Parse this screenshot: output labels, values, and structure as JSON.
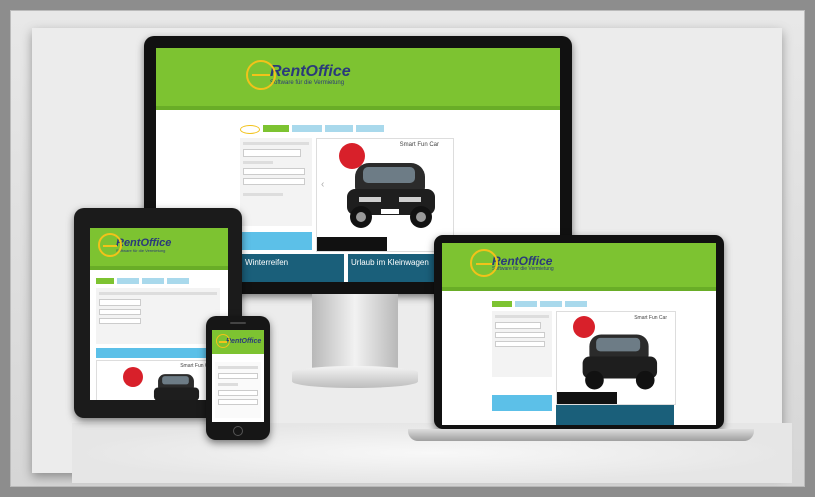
{
  "brand": {
    "name": "RentOffice",
    "tagline": "Software für die Vermietung",
    "colors": {
      "green": "#7dc331",
      "blue": "#2a3a7a",
      "yellow": "#f2c21a",
      "teal": "#1a5f7a",
      "red": "#d8202a",
      "cyan": "#5cc0e8"
    }
  },
  "desktop": {
    "promo_title": "Smart Fun Car",
    "tile1_title": "Winterreifen",
    "tile2_title": "Urlaub im Kleinwagen"
  },
  "laptop": {
    "promo_title": "Smart Fun Car"
  },
  "tablet": {
    "promo_title": "Smart Fun Car"
  },
  "icons": [
    "logo-ring-icon",
    "chevron-left-icon",
    "car-image"
  ]
}
